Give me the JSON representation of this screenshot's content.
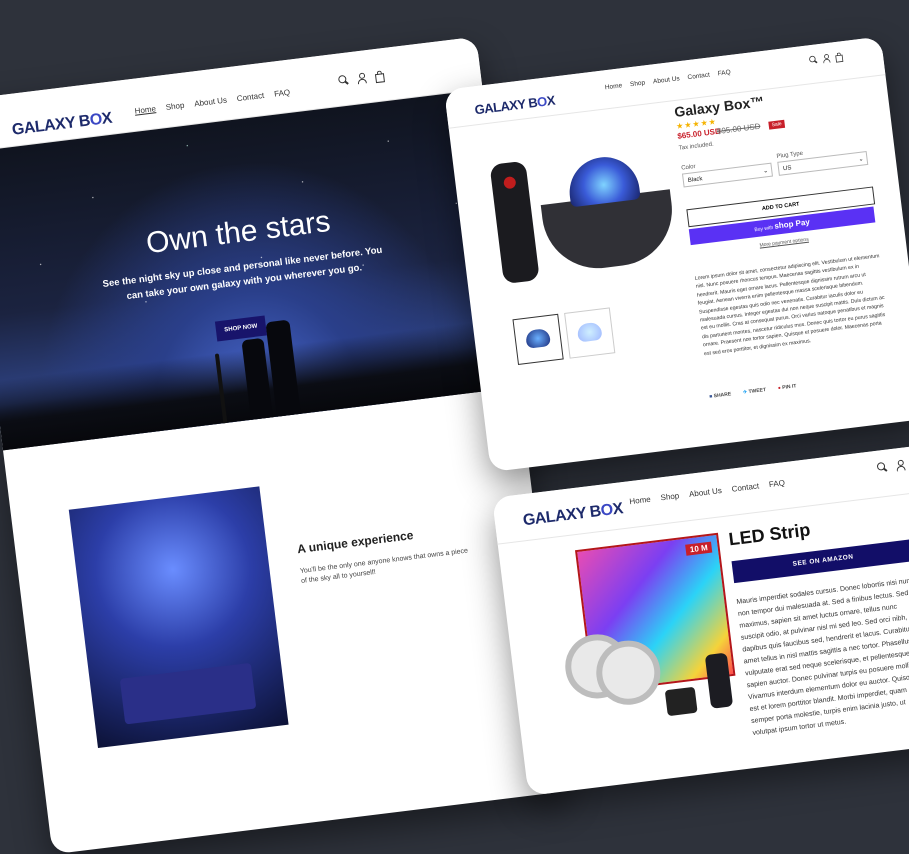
{
  "brand": {
    "logo_main": "GALAXY B",
    "logo_accent": "O",
    "logo_end": "X"
  },
  "nav": [
    "Home",
    "Shop",
    "About Us",
    "Contact",
    "FAQ"
  ],
  "home": {
    "hero_title": "Own the stars",
    "hero_subtitle": "See the night sky up close and personal like never before. You can take your own galaxy with you wherever you go.",
    "hero_button": "SHOP NOW",
    "feature_title": "A unique experience",
    "feature_text": "You'll be the only one anyone knows that owns a piece of the sky all to yourself!"
  },
  "product": {
    "title": "Galaxy Box™",
    "stars": "★★★★★",
    "price": "$65.00 USD",
    "old_price": "$95.00 USD",
    "sale_badge": "Sale",
    "tax_note": "Tax included.",
    "color_label": "Color",
    "color_value": "Black",
    "plug_label": "Plug Type",
    "plug_value": "US",
    "add_to_cart": "ADD TO CART",
    "buy_prefix": "Buy with",
    "buy_brand": "shop Pay",
    "more_payment": "More payment options",
    "description": "Lorem ipsum dolor sit amet, consectetur adipiscing elit. Vestibulum ut elementum nisl. Nunc posuere rhoncus tempus. Maecenas sagittis vestibulum ex in hendrerit. Mauris eget ornare lacus. Pellentesque dignissim rutrum arcu ut feugiat. Aenean viverra enim pellentesque massa scelerisque bibendum. Suspendisse egestas quis odio nec venenatis. Curabitur iaculis dolor eu malesuada cursus. Integer egestas dui non neque suscipit mattis. Duis dictum ac est eu mollis. Cras at consequat purus. Orci varius natoque penatibus et magnis dis parturient montes, nascetur ridiculus mus. Donec quis tortor eu purus sagittis ornare. Praesent non tortor sapien. Quisque et posuere dolor. Maecenas porta est sed eros porttitor, et dignissim ex maximus.",
    "share": "SHARE",
    "tweet": "TWEET",
    "pin": "PIN IT"
  },
  "led": {
    "title": "LED Strip",
    "badge": "10 M",
    "button": "SEE ON AMAZON",
    "description": "Mauris imperdiet sodales cursus. Donec lobortis nisi nunc, non tempor dui malesuada at. Sed a finibus lectus. Sed maximus, sapien sit amet luctus ornare, tellus nunc suscipit odio, at pulvinar nisl mi sed leo. Sed orci nibh, dapibus quis faucibus sed, hendrerit et lacus. Curabitur sit amet tellus in nisl mattis sagittis a nec tortor. Phasellus vulputate erat sed neque scelerisque, et pellentesque sapien auctor. Donec pulvinar turpis eu posuere mollis. Vivamus interdum elementum dolor eu auctor. Quisque ut est et lorem porttitor blandit. Morbi imperdiet, quam semper porta molestie, turpis enim lacinia justo, ut volutpat ipsum tortor ut metus."
  },
  "colors": {
    "background": "#2e323b",
    "brand_navy": "#1d2a6b",
    "button_navy": "#18146b",
    "sale_red": "#c81f2a",
    "shop_pay": "#5a31f4",
    "star": "#f5b301"
  }
}
